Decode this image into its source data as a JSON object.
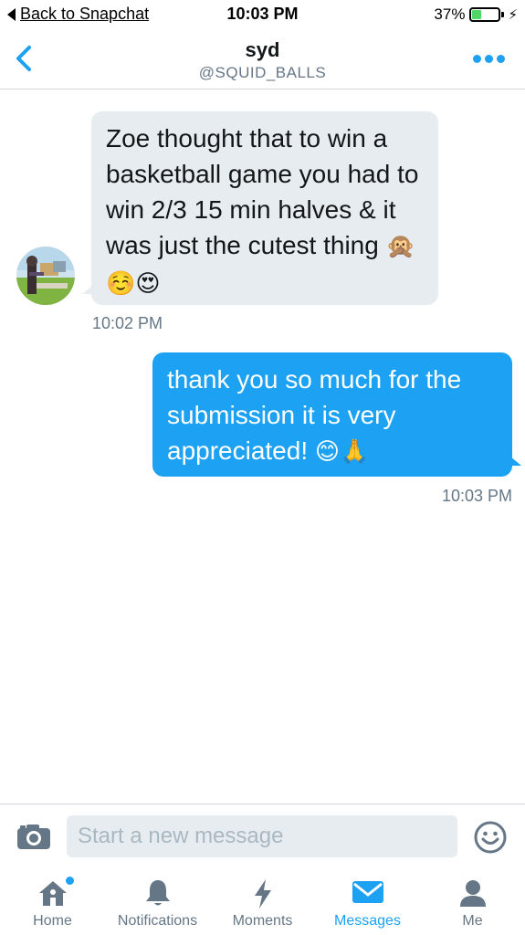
{
  "status_bar": {
    "back_label": "Back to Snapchat",
    "time": "10:03 PM",
    "battery": "37%",
    "battery_level": 0.37
  },
  "header": {
    "name": "syd",
    "handle": "@SQUID_BALLS",
    "back_icon": "chevron-left-icon",
    "more_icon": "more-dots-icon"
  },
  "messages": [
    {
      "direction": "incoming",
      "text": "Zoe thought that to win a basketball game you had to win 2/3 15 min halves & it was just the cutest thing",
      "emojis": "🙊☺️😍",
      "time": "10:02 PM"
    },
    {
      "direction": "outgoing",
      "text": "thank you so much for the submission it is very appreciated!",
      "emojis": "😊🙏",
      "time": "10:03 PM"
    }
  ],
  "compose": {
    "placeholder": "Start a new message",
    "camera_icon": "camera-icon",
    "emoji_icon": "smiley-icon"
  },
  "tabs": [
    {
      "label": "Home",
      "icon": "home-icon",
      "active": false
    },
    {
      "label": "Notifications",
      "icon": "bell-icon",
      "active": false
    },
    {
      "label": "Moments",
      "icon": "lightning-icon",
      "active": false
    },
    {
      "label": "Messages",
      "icon": "envelope-icon",
      "active": true
    },
    {
      "label": "Me",
      "icon": "person-icon",
      "active": false
    }
  ],
  "colors": {
    "accent": "#1da1f2",
    "bubble_incoming": "#e6ecf0",
    "muted_text": "#657786",
    "battery_green": "#4cd964"
  }
}
